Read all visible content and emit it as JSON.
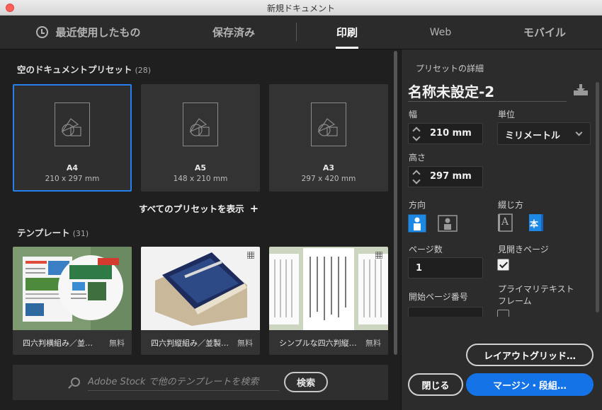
{
  "window": {
    "title": "新規ドキュメント"
  },
  "tabs": [
    {
      "label": "最近使用したもの"
    },
    {
      "label": "保存済み"
    },
    {
      "label": "印刷"
    },
    {
      "label": "Web"
    },
    {
      "label": "モバイル"
    }
  ],
  "presets_section": {
    "title": "空のドキュメントプリセット",
    "count": "(28)"
  },
  "presets": [
    {
      "name": "A4",
      "size": "210 x 297 mm"
    },
    {
      "name": "A5",
      "size": "148 x 210 mm"
    },
    {
      "name": "A3",
      "size": "297 x 420 mm"
    }
  ],
  "view_all": {
    "label": "すべてのプリセットを表示",
    "icon": "+"
  },
  "templates_section": {
    "title": "テンプレート",
    "count": "(31)"
  },
  "templates": [
    {
      "name": "四六判横組み／並…",
      "price": "無料"
    },
    {
      "name": "四六判縦組み／並製…",
      "price": "無料"
    },
    {
      "name": "シンプルな四六判縦…",
      "price": "無料"
    }
  ],
  "search": {
    "placeholder": "Adobe Stock で他のテンプレートを検索",
    "button": "検索"
  },
  "details": {
    "title": "プリセットの詳細",
    "preset_name": "名称未設定-2",
    "width_label": "幅",
    "width_value": "210 mm",
    "unit_label": "単位",
    "unit_value": "ミリメートル",
    "height_label": "高さ",
    "height_value": "297 mm",
    "orientation_label": "方向",
    "binding_label": "綴じ方",
    "binding_left_glyph": "A",
    "binding_right_glyph": "本",
    "pages_label": "ページ数",
    "pages_value": "1",
    "facing_label": "見開きページ",
    "start_page_label": "開始ページ番号",
    "primary_text_label_1": "プライマリテキスト",
    "primary_text_label_2": "フレーム"
  },
  "buttons": {
    "layout_grid": "レイアウトグリッド…",
    "close": "閉じる",
    "margins": "マージン・段組…"
  },
  "colors": {
    "accent": "#1473e6",
    "selection": "#2680eb",
    "icon_blue": "#1e88e5"
  }
}
